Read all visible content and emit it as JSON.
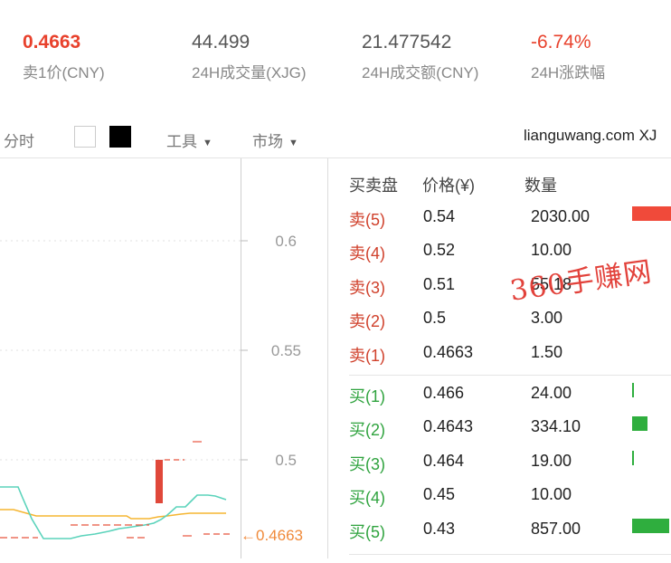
{
  "stats": [
    {
      "value": "0.4663",
      "label": "卖1价(CNY)"
    },
    {
      "value": "44.499",
      "label": "24H成交量(XJG)"
    },
    {
      "value": "21.477542",
      "label": "24H成交额(CNY)"
    },
    {
      "value": "-6.74%",
      "label": "24H涨跌幅"
    }
  ],
  "toolbar": {
    "fenshi": "分时",
    "tools": "工具",
    "market": "市场",
    "site": "lianguwang.com XJ",
    "caret": "▼"
  },
  "chart": {
    "y_ticks": [
      "0.6",
      "0.55",
      "0.5"
    ],
    "current_price_label": "←0.4663",
    "colors": {
      "line1": "#5bd3bb",
      "line2": "#f5b531",
      "candle": "#e0483a",
      "ref": "#e8553f",
      "price": "#f08a3a"
    }
  },
  "orderbook": {
    "headers": {
      "side": "买卖盘",
      "price": "价格(¥)",
      "qty": "数量"
    },
    "asks": [
      {
        "label": "卖(5)",
        "price": "0.54",
        "qty": "2030.00",
        "depth": 1.0
      },
      {
        "label": "卖(4)",
        "price": "0.52",
        "qty": "10.00",
        "depth": 0
      },
      {
        "label": "卖(3)",
        "price": "0.51",
        "qty": "55.18",
        "depth": 0
      },
      {
        "label": "卖(2)",
        "price": "0.5",
        "qty": "3.00",
        "depth": 0
      },
      {
        "label": "卖(1)",
        "price": "0.4663",
        "qty": "1.50",
        "depth": 0
      }
    ],
    "bids": [
      {
        "label": "买(1)",
        "price": "0.466",
        "qty": "24.00",
        "depth": 0.04
      },
      {
        "label": "买(2)",
        "price": "0.4643",
        "qty": "334.10",
        "depth": 0.4
      },
      {
        "label": "买(3)",
        "price": "0.464",
        "qty": "19.00",
        "depth": 0.03
      },
      {
        "label": "买(4)",
        "price": "0.45",
        "qty": "10.00",
        "depth": 0
      },
      {
        "label": "买(5)",
        "price": "0.43",
        "qty": "857.00",
        "depth": 1.0
      }
    ]
  },
  "watermark": "360手赚网"
}
